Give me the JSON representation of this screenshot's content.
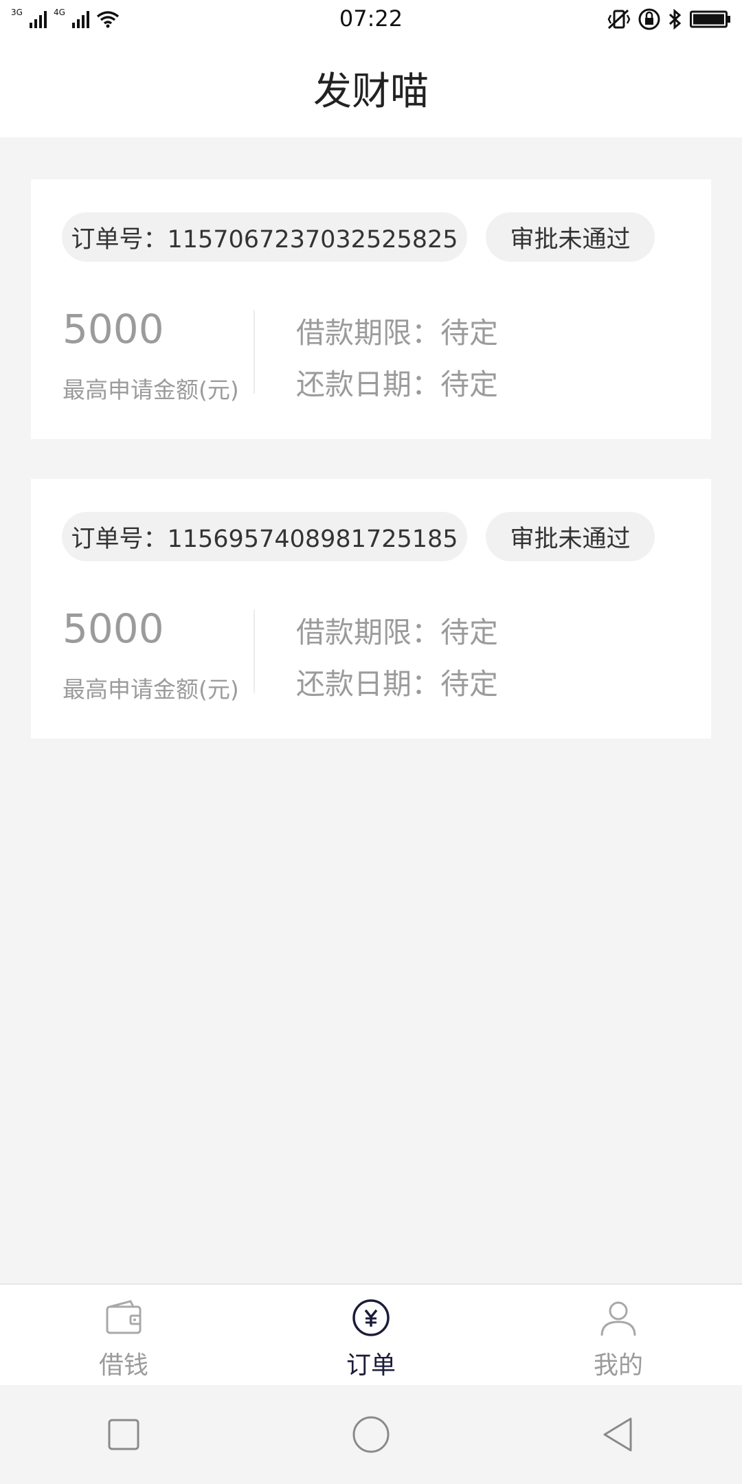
{
  "status_bar": {
    "net1": "3G",
    "net2": "4G",
    "time": "07:22"
  },
  "header": {
    "title": "发财喵"
  },
  "orders": [
    {
      "order_label": "订单号：1157067237032525825",
      "status": "审批未通过",
      "amount": "5000",
      "amount_label": "最高申请金额(元)",
      "term": "借款期限：待定",
      "repay_date": "还款日期：待定"
    },
    {
      "order_label": "订单号：1156957408981725185",
      "status": "审批未通过",
      "amount": "5000",
      "amount_label": "最高申请金额(元)",
      "term": "借款期限：待定",
      "repay_date": "还款日期：待定"
    }
  ],
  "tabs": [
    {
      "label": "借钱",
      "icon": "wallet-icon",
      "active": false
    },
    {
      "label": "订单",
      "icon": "yuan-icon",
      "active": true
    },
    {
      "label": "我的",
      "icon": "user-icon",
      "active": false
    }
  ],
  "colors": {
    "accent": "#1c1c3a",
    "muted": "#9b9b9b",
    "background": "#f4f4f4"
  }
}
